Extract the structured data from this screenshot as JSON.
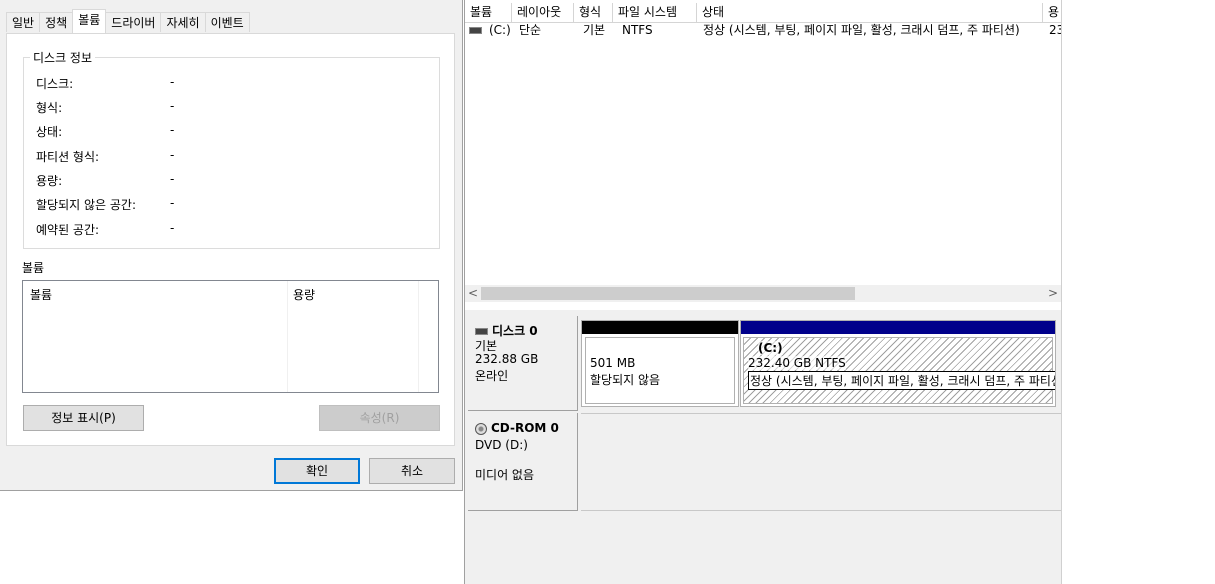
{
  "dialog": {
    "tabs": [
      "일반",
      "정책",
      "볼륨",
      "드라이버",
      "자세히",
      "이벤트"
    ],
    "active_tab": "볼륨",
    "disk_info": {
      "title": "디스크 정보",
      "rows": [
        {
          "label": "디스크:",
          "value": "-"
        },
        {
          "label": "형식:",
          "value": "-"
        },
        {
          "label": "상태:",
          "value": "-"
        },
        {
          "label": "파티션 형식:",
          "value": "-"
        },
        {
          "label": "용량:",
          "value": "-"
        },
        {
          "label": "할당되지 않은 공간:",
          "value": "-"
        },
        {
          "label": "예약된 공간:",
          "value": "-"
        }
      ]
    },
    "volumes_label": "볼륨",
    "volumes_columns": [
      "볼륨",
      "용량"
    ],
    "populate_button": "정보 표시(P)",
    "properties_button": "속성(R)",
    "ok_button": "확인",
    "cancel_button": "취소"
  },
  "diskmgmt": {
    "columns": [
      "볼륨",
      "레이아웃",
      "형식",
      "파일 시스템",
      "상태",
      "용"
    ],
    "rows": [
      {
        "volume": "(C:)",
        "layout": "단순",
        "type": "기본",
        "fs": "NTFS",
        "status": "정상 (시스템, 부팅, 페이지 파일, 활성, 크래시 덤프, 주 파티션)",
        "capacity": "23"
      }
    ],
    "scroll_left": "<",
    "scroll_right": ">",
    "disks": [
      {
        "name": "디스크 0",
        "type": "기본",
        "size": "232.88 GB",
        "state": "온라인",
        "icon": "disk-icon",
        "partitions": [
          {
            "size": "501 MB",
            "status": "할당되지 않음",
            "header_color": "#000000"
          },
          {
            "label": "(C:)",
            "size": "232.40 GB NTFS",
            "status": "정상 (시스템, 부팅, 페이지 파일, 활성, 크래시 덤프, 주 파티션)",
            "header_color": "#00008b"
          }
        ]
      },
      {
        "name": "CD-ROM 0",
        "type": "DVD (D:)",
        "state": "미디어 없음",
        "icon": "cdrom-icon"
      }
    ]
  },
  "colors": {
    "accent": "#0078d7",
    "dialog_bg": "#f0f0f0"
  }
}
